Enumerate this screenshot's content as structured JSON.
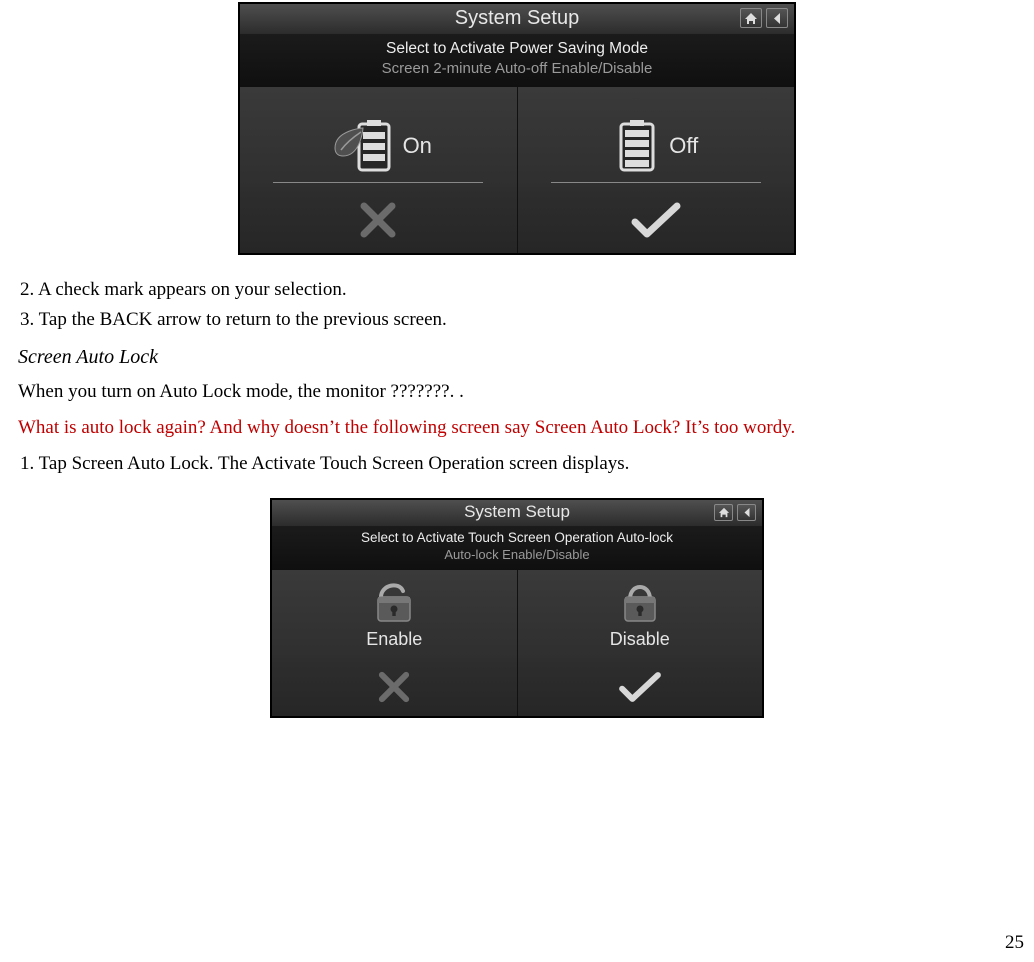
{
  "page_number": "25",
  "screenshot1": {
    "title": "System Setup",
    "banner_line1": "Select to Activate Power Saving Mode",
    "banner_line2": "Screen 2-minute Auto-off Enable/Disable",
    "option_on": "On",
    "option_off": "Off",
    "home_icon": "home-icon",
    "back_icon": "back-icon",
    "cancel_icon": "cancel-icon",
    "confirm_icon": "confirm-icon"
  },
  "body": {
    "step2": "2. A check mark appears on your selection.",
    "step3": "3. Tap the BACK arrow to return to the previous screen.",
    "subhead": "Screen Auto Lock",
    "para1": "When you turn on Auto Lock mode, the monitor ???????. .",
    "red_comment": "What is auto lock again? And why doesn’t the following screen say Screen Auto Lock? It’s too wordy.",
    "step1b": "1. Tap Screen Auto Lock. The Activate Touch Screen Operation screen displays."
  },
  "screenshot2": {
    "title": "System Setup",
    "banner_line1": "Select to Activate Touch Screen Operation Auto-lock",
    "banner_line2": "Auto-lock Enable/Disable",
    "option_enable": "Enable",
    "option_disable": "Disable",
    "home_icon": "home-icon",
    "back_icon": "back-icon",
    "cancel_icon": "cancel-icon",
    "confirm_icon": "confirm-icon"
  }
}
